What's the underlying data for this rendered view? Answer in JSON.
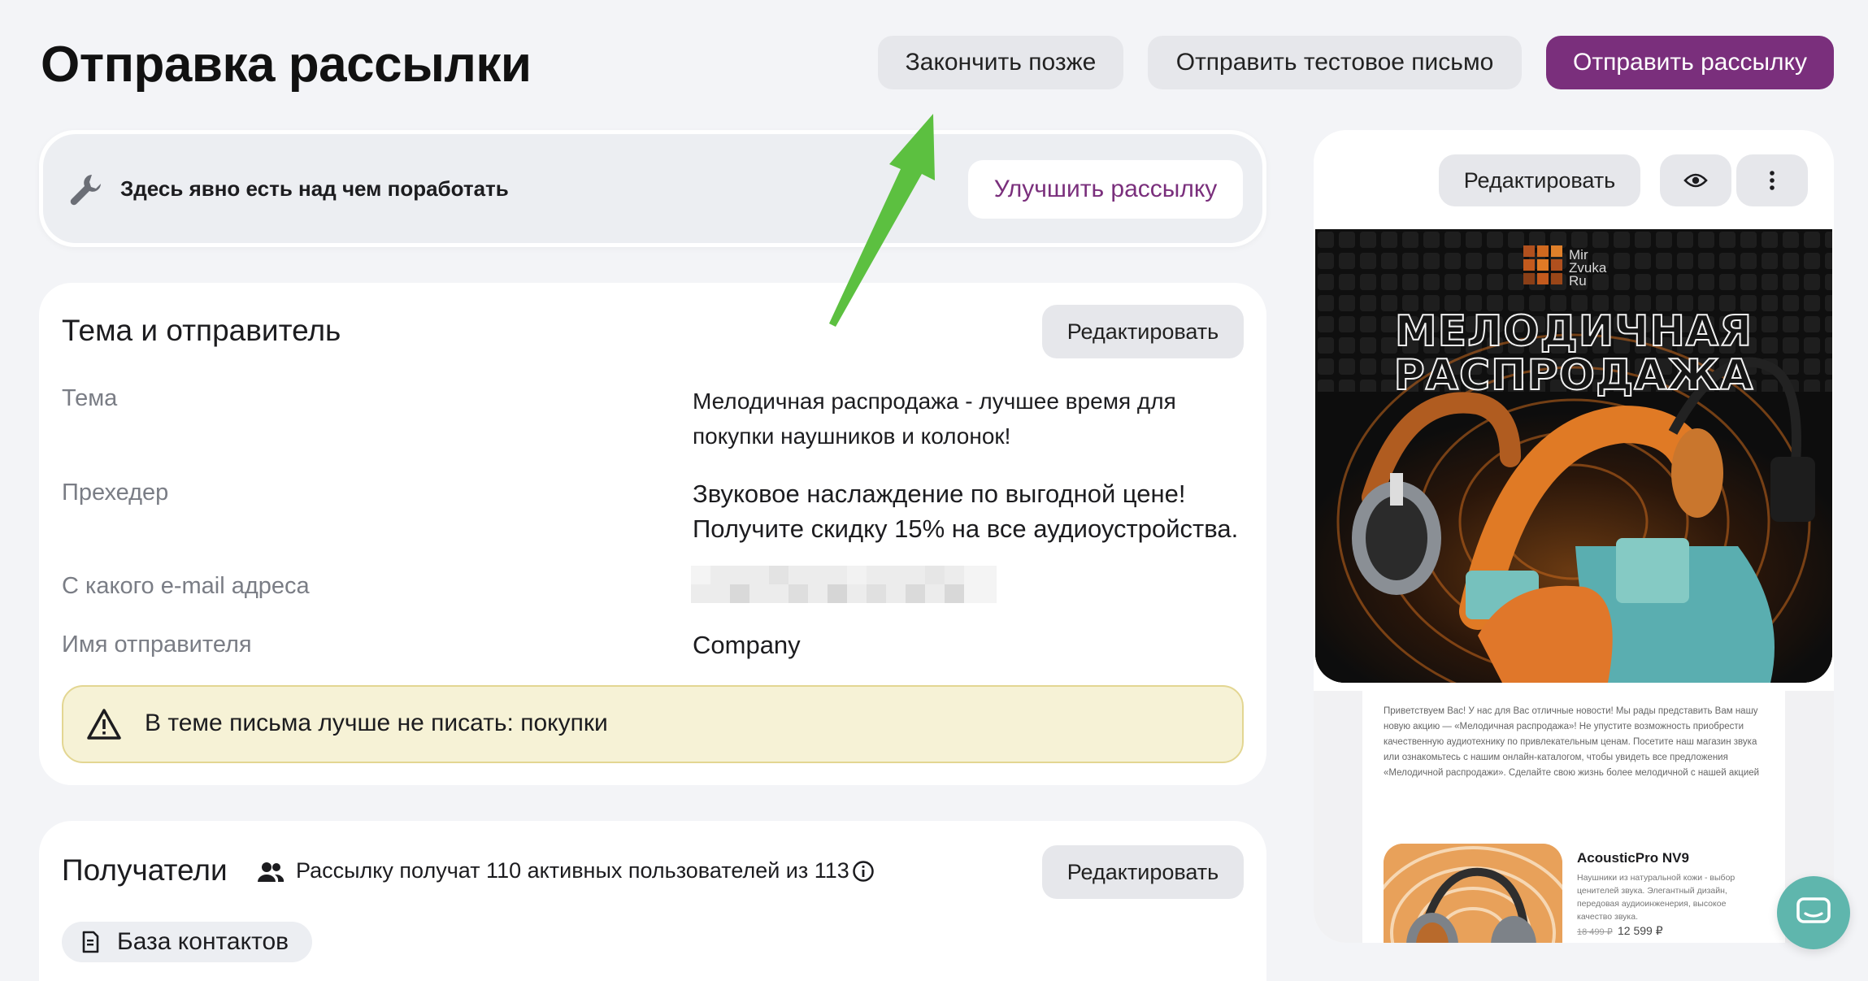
{
  "header": {
    "title": "Отправка рассылки",
    "finish_later": "Закончить позже",
    "send_test": "Отправить тестовое письмо",
    "send_campaign": "Отправить рассылку"
  },
  "hint": {
    "text": "Здесь явно есть над чем поработать",
    "improve_button": "Улучшить рассылку"
  },
  "subject_section": {
    "title": "Тема и отправитель",
    "edit_button": "Редактировать",
    "rows": [
      {
        "label": "Тема",
        "value_line1": "Мелодичная распродажа - лучшее время для",
        "value_line2": "покупки наушников и колонок!"
      },
      {
        "label": "Прехедер",
        "value_line1": "Звуковое наслаждение по выгодной цене!",
        "value_line2": "Получите скидку 15% на все аудиоустройства."
      },
      {
        "label": "С какого e-mail адреса",
        "value": ""
      },
      {
        "label": "Имя отправителя",
        "value": "Company"
      }
    ],
    "warning": "В теме письма лучше не писать: покупки"
  },
  "recipients": {
    "title": "Получатели",
    "summary": "Рассылку получат 110 активных пользователей из 113",
    "edit_button": "Редактировать",
    "chip": "База контактов"
  },
  "preview": {
    "edit_button": "Редактировать",
    "brand_line1": "Mir",
    "brand_line2": "Zvuka",
    "brand_line3": "Ru",
    "hero_line1": "МЕЛОДИЧНАЯ",
    "hero_line2": "РАСПРОДАЖА",
    "body_text": "Приветствуем Вас! У нас для Вас отличные новости! Мы рады представить Вам нашу новую акцию — «Мелодичная распродажа»! Не упустите возможность приобрести качественную аудиотехнику по привлекательным ценам. Посетите наш магазин звука или ознакомьтесь с нашим онлайн-каталогом, чтобы увидеть все предложения «Мелодичной распродажи». Сделайте свою жизнь более мелодичной с нашей акцией",
    "product_name": "AcousticPro NV9",
    "product_desc": "Наушники из натуральной кожи - выбор ценителей звука. Элегантный дизайн, передовая аудиоинженерия, высокое качество звука.",
    "old_price": "18 499 ₽",
    "new_price": "12 599 ₽"
  },
  "colors": {
    "accent": "#7a2f7c",
    "background": "#f3f4f7",
    "warning_bg": "#f6f2d6",
    "arrow": "#5cc040",
    "chat": "#5fb6ad"
  }
}
